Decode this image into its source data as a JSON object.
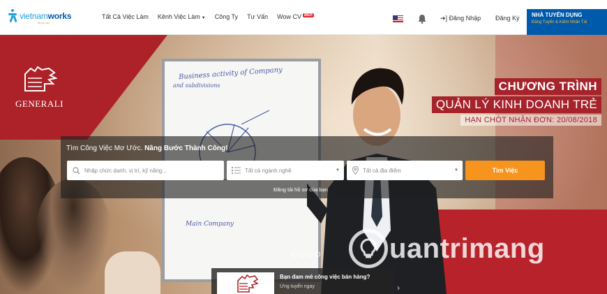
{
  "header": {
    "logo": {
      "word_light": "vietnam",
      "word_bold": "works",
      "tagline": "Move Up!"
    },
    "nav": [
      {
        "label": "Tất Cả Việc Làm",
        "caret": false,
        "badge": ""
      },
      {
        "label": "Kênh Việc Làm",
        "caret": true,
        "badge": ""
      },
      {
        "label": "Công Ty",
        "caret": false,
        "badge": ""
      },
      {
        "label": "Tư Vấn",
        "caret": false,
        "badge": ""
      },
      {
        "label": "Wow CV",
        "caret": false,
        "badge": "MỚI"
      }
    ],
    "login_label": "Đăng Nhập",
    "register_label": "Đăng Ký",
    "employer_title": "NHÀ TUYỂN DỤNG",
    "employer_subtitle": "Đăng Tuyển & Kiếm Nhân Tài"
  },
  "hero": {
    "brand": "GENERALI",
    "board_text_1": "Business activity of Company",
    "board_text_2": "and subdivisions",
    "board_text_3": "Main Company",
    "headline_1": "CHƯƠNG TRÌNH",
    "headline_2": "QUẢN LÝ KINH DOANH TRẺ",
    "headline_3": "HẠN CHÓT NHẬN ĐƠN: 20/08/2018"
  },
  "search": {
    "slogan_normal": "Tìm Công Việc Mơ Ước. ",
    "slogan_bold": "Nâng Bước Thành Công!",
    "keyword_placeholder": "Nhập chức danh, vị trí, kỹ năng...",
    "industry_value": "Tất cả ngành nghề",
    "location_value": "Tất cả địa điểm",
    "submit_label": "Tìm Việc",
    "upload_link": "Đăng tải hồ sơ của bạn"
  },
  "promo": {
    "title": "Bạn đam mê công việc bán hàng?",
    "cta": "Ứng tuyển ngay"
  },
  "watermark": "uantrimang",
  "colors": {
    "brand_blue": "#005aab",
    "accent_orange": "#f7941d",
    "generali_red": "#ad2228"
  }
}
